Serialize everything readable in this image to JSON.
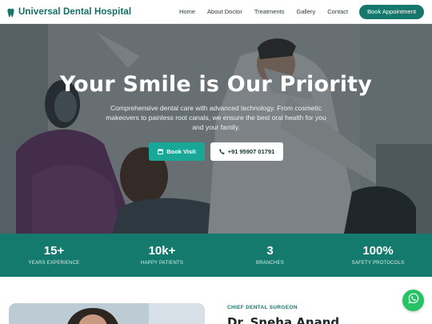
{
  "header": {
    "brand": "Universal Dental Hospital",
    "nav": [
      "Home",
      "About Doctor",
      "Treatments",
      "Gallery",
      "Contact"
    ],
    "cta": "Book Appointment"
  },
  "hero": {
    "title": "Your Smile is Our Priority",
    "subtitle": "Comprehensive dental care with advanced technology. From cosmetic makeovers to painless root canals, we ensure the best oral health for you and your family.",
    "primary_button": "Book Visit",
    "secondary_button": "+91 95907 01791"
  },
  "stats": [
    {
      "value": "15+",
      "label": "YEARS EXPERIENCE"
    },
    {
      "value": "10k+",
      "label": "HAPPY PATIENTS"
    },
    {
      "value": "3",
      "label": "BRANCHES"
    },
    {
      "value": "100%",
      "label": "SAFETY PROTOCOLS"
    }
  ],
  "doctor": {
    "kicker": "CHIEF DENTAL SURGEON",
    "name": "Dr. Sneha Anand"
  },
  "colors": {
    "brand": "#16786c",
    "accent": "#19a898",
    "whatsapp": "#25c365"
  },
  "icons": {
    "brand": "tooth-icon",
    "book_visit": "calendar-icon",
    "call": "phone-icon",
    "float": "whatsapp-icon"
  }
}
